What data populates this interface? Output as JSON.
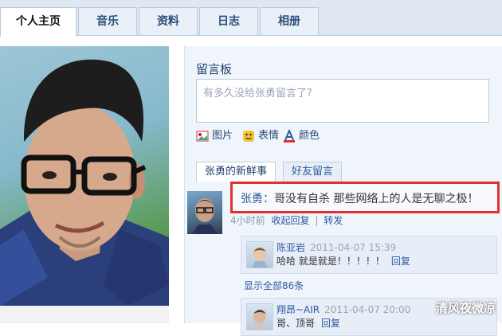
{
  "tabs": [
    "个人主页",
    "音乐",
    "资料",
    "日志",
    "相册"
  ],
  "message_board": {
    "title": "留言板",
    "placeholder": "有多久没给张勇留言了?",
    "tools": {
      "image_label": "图片",
      "emoji_label": "表情",
      "color_label": "颜色"
    }
  },
  "subtabs": [
    "张勇的新鲜事",
    "好友留言"
  ],
  "status": {
    "name": "张勇：",
    "text": "哥没有自杀 那些网络上的人是无聊之极！",
    "time": "4小时前",
    "collapse": "收起回复",
    "sep": "|",
    "forward": "转发"
  },
  "comments": [
    {
      "name": "陈亚岩",
      "time": "2011-04-07 15:39",
      "text": "哈哈 就是就是！！！！！",
      "reply": "回复"
    },
    {
      "name": "翔昂~AIR",
      "time": "2011-04-07 20:00",
      "text": "哥、顶哥",
      "reply": "回复"
    }
  ],
  "show_all": "显示全部86条",
  "watermark": "清风夜微凉",
  "colors": {
    "accent": "#2c5aa0",
    "highlight": "#e03131"
  }
}
